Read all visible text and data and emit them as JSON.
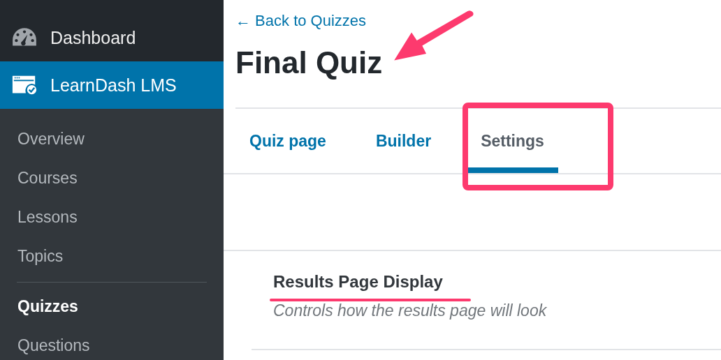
{
  "sidebar": {
    "items": [
      {
        "label": "Dashboard",
        "kind": "gauge",
        "selected": false
      },
      {
        "label": "LearnDash LMS",
        "kind": "course",
        "selected": true
      }
    ],
    "submenu": [
      {
        "label": "Overview",
        "selected": false
      },
      {
        "label": "Courses",
        "selected": false
      },
      {
        "label": "Lessons",
        "selected": false
      },
      {
        "label": "Topics",
        "selected": false,
        "divider_after": true
      },
      {
        "label": "Quizzes",
        "selected": true
      },
      {
        "label": "Questions",
        "selected": false
      }
    ]
  },
  "back_link": "← Back to Quizzes",
  "title": "Final Quiz",
  "tabs": [
    {
      "label": "Quiz page",
      "selected": false
    },
    {
      "label": "Builder",
      "selected": false
    },
    {
      "label": "Settings",
      "selected": true
    }
  ],
  "section": {
    "heading": "Results Page Display",
    "description": "Controls how the results page will look"
  }
}
